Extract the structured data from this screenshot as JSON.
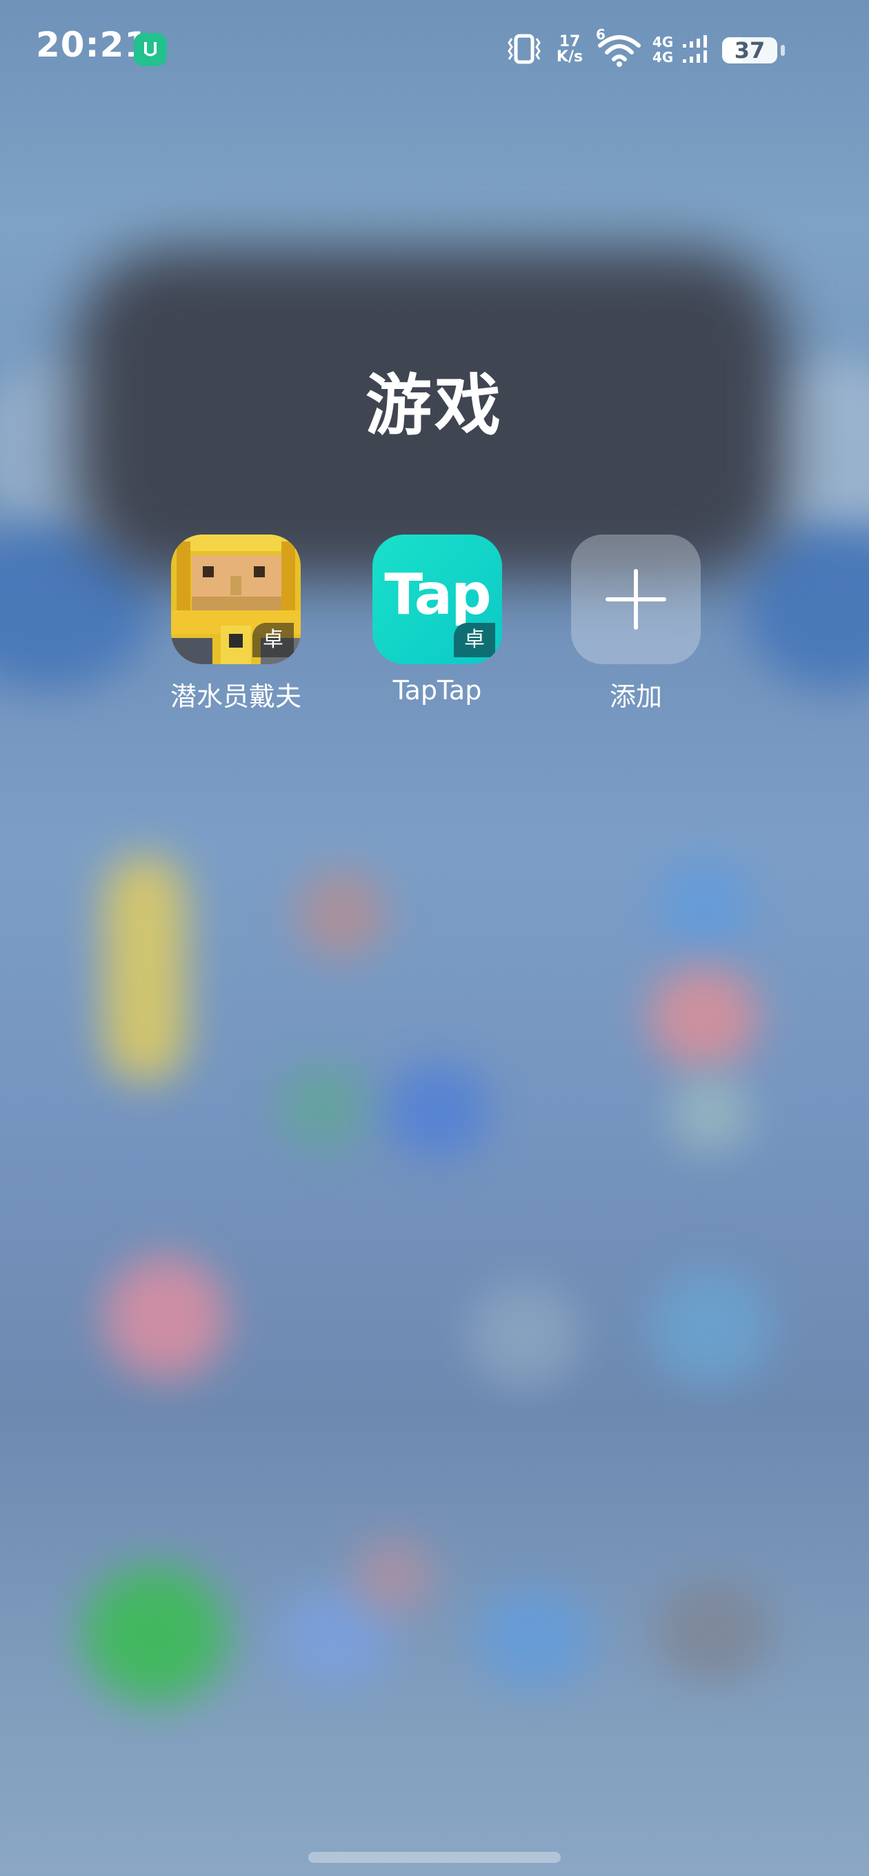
{
  "status_bar": {
    "time": "20:21",
    "netspeed_value": "17",
    "netspeed_unit": "K/s",
    "wifi_badge": "6",
    "network_1": "4G",
    "network_2": "4G",
    "battery_level": "37",
    "icons": [
      "mi-home-icon",
      "vibrate-icon",
      "wifi-icon",
      "signal-icon",
      "battery-icon"
    ]
  },
  "folder": {
    "title": "游戏",
    "apps": [
      {
        "label": "潜水员戴夫",
        "icon": "dave-the-diver-icon",
        "badge": "卓"
      },
      {
        "label": "TapTap",
        "icon": "taptap-icon",
        "icon_text": "Tap",
        "badge": "卓"
      },
      {
        "label": "添加",
        "icon": "add-icon"
      }
    ]
  },
  "colors": {
    "taptap_brand": "#0fd2c6",
    "mi_green": "#22c18e",
    "dave_yellow": "#e8c12a"
  }
}
